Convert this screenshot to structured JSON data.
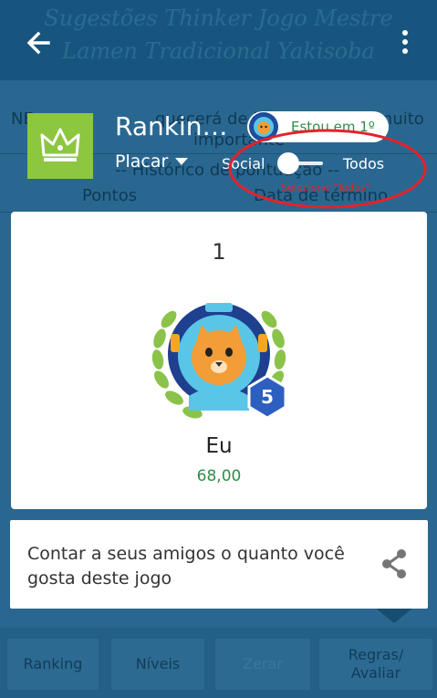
{
  "background": {
    "script_line1": "Sugestões Thinker Jogo Mestre",
    "script_line2": "Lamen Tradicional Yakisoba",
    "message_partial_left": "NE",
    "message_partial_main": "quecerá de ler as regras... muito",
    "message_line2": "importante",
    "message_line3": "-- Histórico de pontuação --",
    "col_points": "Pontos",
    "col_end_date": "Data de término",
    "buttons": [
      "Ranking",
      "Níveis",
      "Zerar",
      "Regras/\nAvaliar"
    ]
  },
  "app_bar": {
    "back_icon": "arrow-left-icon",
    "menu_icon": "more-vert-icon"
  },
  "header": {
    "title": "Rankin…",
    "dropdown_label": "Placar",
    "rank_pill_text": "Estou em 1º",
    "toggle_left_label": "Social",
    "toggle_right_label": "Todos",
    "annotation_hint": "Selecione \"Todos\"",
    "colors": {
      "crown_tile": "#8dc63f",
      "annotation": "#e3222b",
      "score_green": "#2e8f48"
    }
  },
  "leaderboard": {
    "place": "1",
    "name": "Eu",
    "score": "68,00",
    "level_badge": "5"
  },
  "share": {
    "text": "Contar a seus amigos o quanto você gosta deste jogo",
    "icon": "share-icon"
  }
}
